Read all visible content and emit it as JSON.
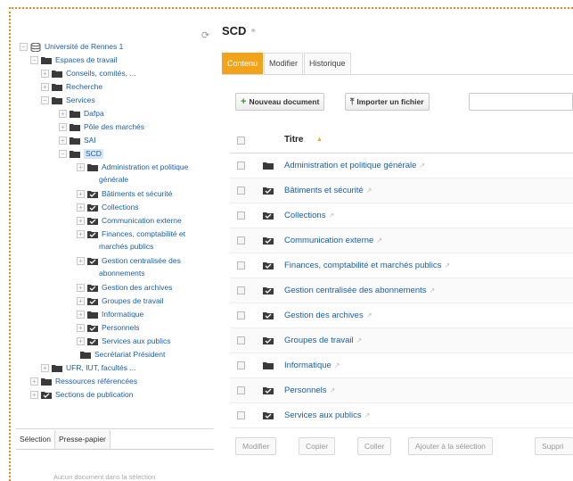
{
  "tree": {
    "items": [
      {
        "label": "Université de Rennes 1",
        "icon": "database-icon"
      },
      {
        "label": "Espaces de travail",
        "icon": "folder-icon"
      },
      {
        "label": "Conseils, comités, ...",
        "icon": "folder-icon"
      },
      {
        "label": "Recherche",
        "icon": "folder-icon"
      },
      {
        "label": "Services",
        "icon": "folder-icon"
      },
      {
        "label": "Dafpa",
        "icon": "folder-icon"
      },
      {
        "label": "Pôle des marchés",
        "icon": "folder-icon"
      },
      {
        "label": "SAI",
        "icon": "folder-icon"
      },
      {
        "label": "SCD",
        "icon": "folder-icon"
      },
      {
        "label": "Administration et politique",
        "label2": "générale",
        "icon": "folder-icon"
      },
      {
        "label": "Bâtiments et sécurité",
        "icon": "folder-check-icon"
      },
      {
        "label": "Collections",
        "icon": "folder-check-icon"
      },
      {
        "label": "Communication externe",
        "icon": "folder-check-icon"
      },
      {
        "label": "Finances, comptabilité et",
        "label2": "marchés publics",
        "icon": "folder-check-icon"
      },
      {
        "label": "Gestion centralisée des",
        "label2": "abonnements",
        "icon": "folder-check-icon"
      },
      {
        "label": "Gestion des archives",
        "icon": "folder-check-icon"
      },
      {
        "label": "Groupes de travail",
        "icon": "folder-check-icon"
      },
      {
        "label": "Informatique",
        "icon": "folder-icon"
      },
      {
        "label": "Personnels",
        "icon": "folder-check-icon"
      },
      {
        "label": "Services aux publics",
        "icon": "folder-check-icon"
      },
      {
        "label": "Secrétariat Président",
        "icon": "folder-icon"
      },
      {
        "label": "UFR, IUT, facultés ...",
        "icon": "folder-icon"
      },
      {
        "label": "Ressources référencées",
        "icon": "folder-icon"
      },
      {
        "label": "Sections de publication",
        "icon": "folder-check-icon"
      }
    ]
  },
  "bottom_tabs": [
    "Sélection",
    "Presse-papier"
  ],
  "bottom_note": "Aucun document dans la sélection",
  "page": {
    "title": "SCD",
    "tabs": [
      "Contenu",
      "Modifier",
      "Historique"
    ],
    "new_doc_label": "Nouveau document",
    "import_label": "Importer un fichier",
    "column_title": "Titre",
    "rows": [
      {
        "title": "Administration et politique générale",
        "icon": "folder-icon"
      },
      {
        "title": "Bâtiments et sécurité",
        "icon": "folder-check-icon"
      },
      {
        "title": "Collections",
        "icon": "folder-check-icon"
      },
      {
        "title": "Communication externe",
        "icon": "folder-check-icon"
      },
      {
        "title": "Finances, comptabilité et marchés publics",
        "icon": "folder-check-icon"
      },
      {
        "title": "Gestion centralisée des abonnements",
        "icon": "folder-check-icon"
      },
      {
        "title": "Gestion des archives",
        "icon": "folder-check-icon"
      },
      {
        "title": "Groupes de travail",
        "icon": "folder-check-icon"
      },
      {
        "title": "Informatique",
        "icon": "folder-icon"
      },
      {
        "title": "Personnels",
        "icon": "folder-check-icon"
      },
      {
        "title": "Services aux publics",
        "icon": "folder-check-icon"
      }
    ],
    "actions": [
      "Modifier",
      "Copier",
      "Coller",
      "Ajouter à la sélection",
      "Suppri"
    ]
  },
  "colors": {
    "accent": "#f3a31a",
    "link": "#1a5fa8",
    "frame": "#e8861a"
  }
}
